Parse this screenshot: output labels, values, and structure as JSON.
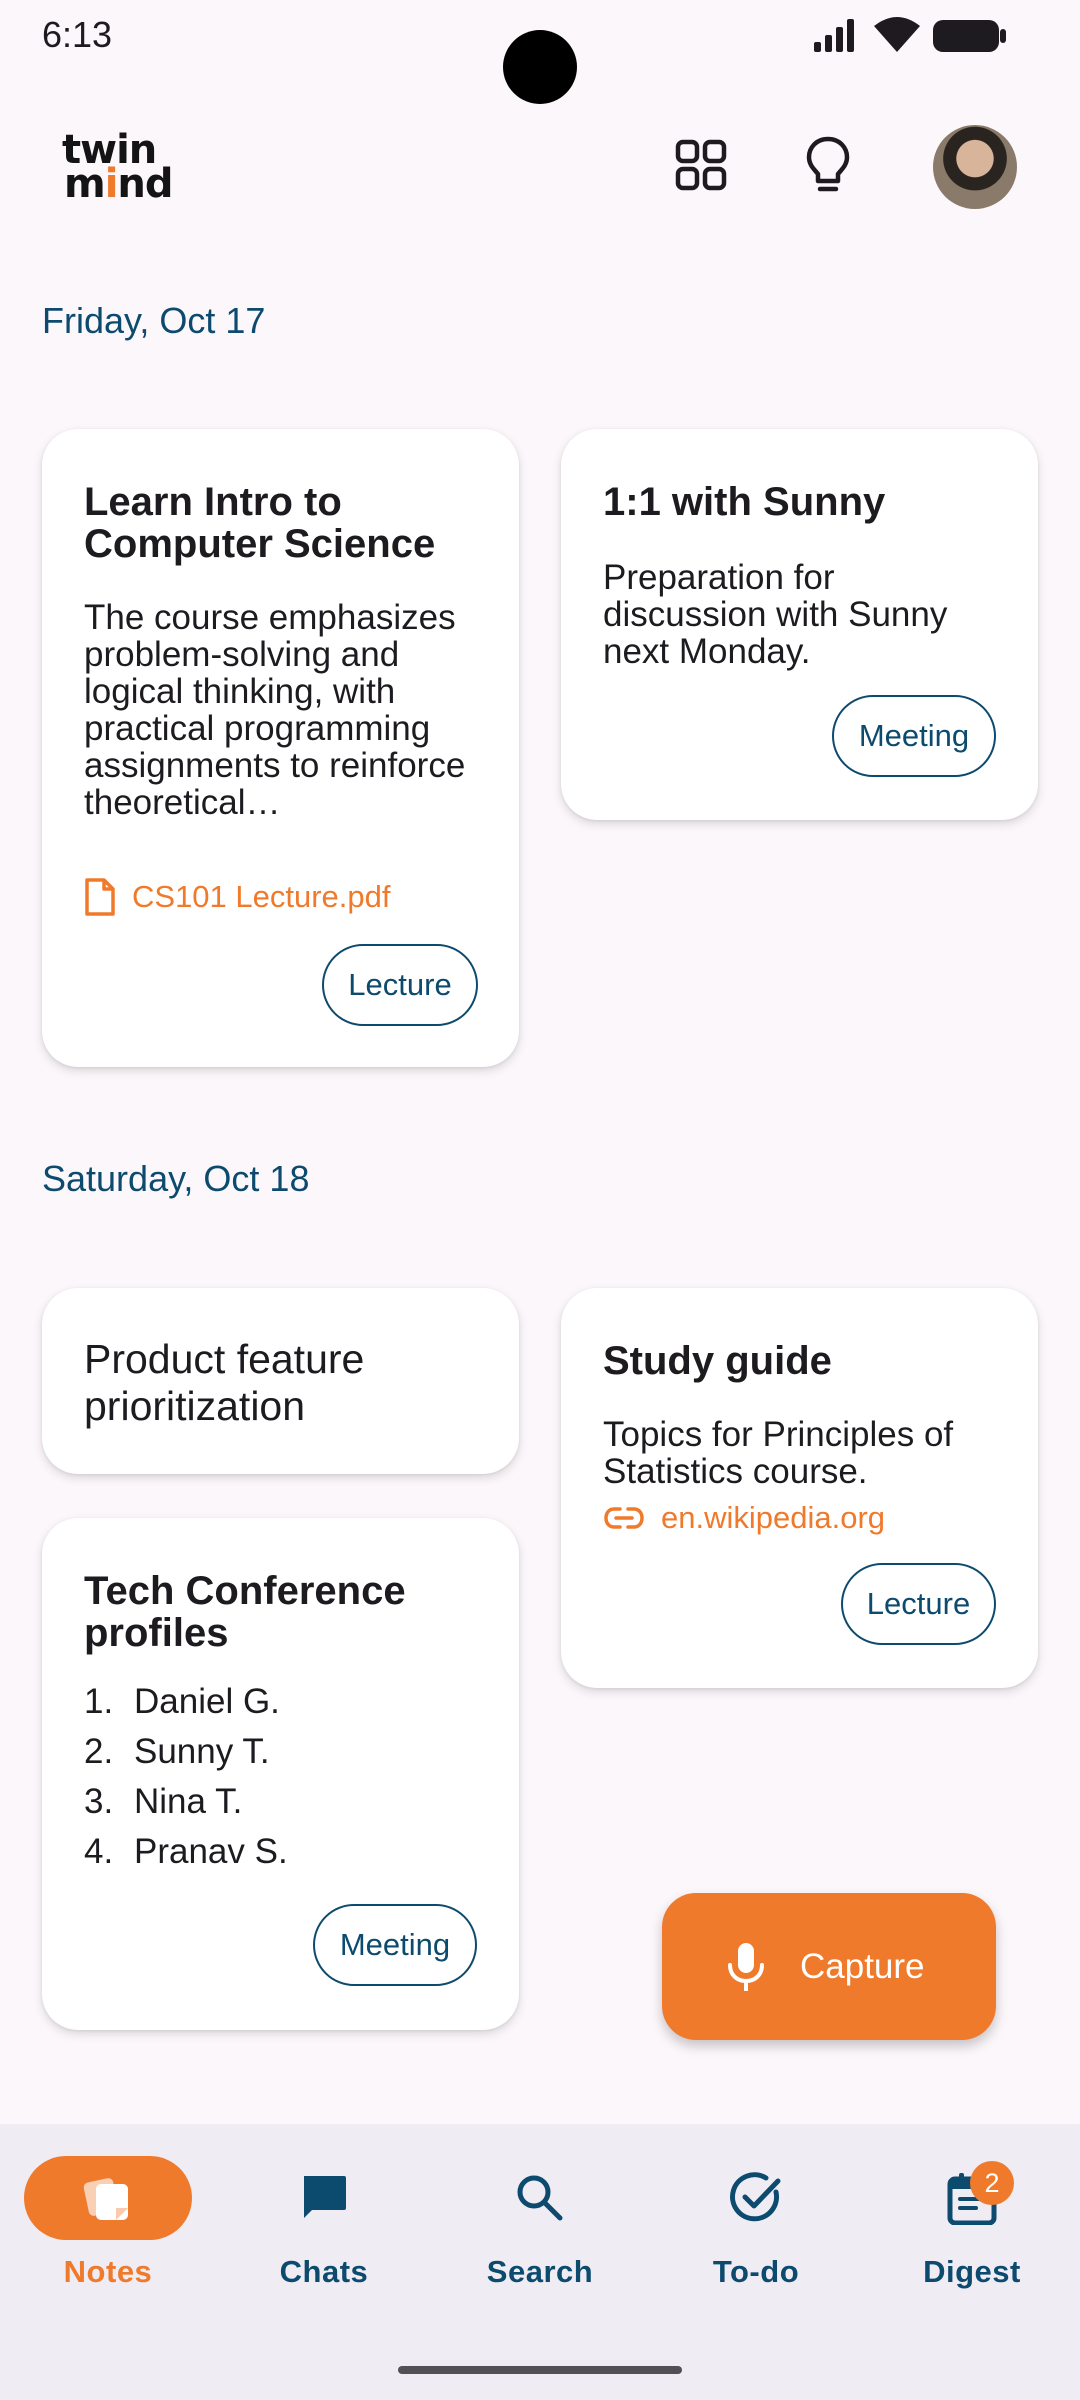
{
  "status_bar": {
    "time": "6:13"
  },
  "header": {
    "logo_line1": "twin",
    "logo_line2_pre": "m",
    "logo_line2_dot": "i",
    "logo_line2_post": "nd",
    "icons": [
      "grid-icon",
      "lightbulb-icon",
      "avatar"
    ]
  },
  "sections": [
    {
      "date": "Friday, Oct 17",
      "cards": [
        {
          "title": "Learn Intro to Computer Science",
          "body": "The course emphasizes problem-solving and logical thinking, with practical programming assignments to reinforce theoretical…",
          "attachment": "CS101 Lecture.pdf",
          "attachment_icon": "file-icon",
          "tag": "Lecture"
        },
        {
          "title": "1:1 with Sunny",
          "body": "Preparation for discussion with Sunny next Monday.",
          "tag": "Meeting"
        }
      ]
    },
    {
      "date": "Saturday, Oct 18",
      "cards": [
        {
          "title": "Product feature prioritization"
        },
        {
          "title": "Study guide",
          "body": "Topics for Principles of Statistics course.",
          "attachment": "en.wikipedia.org",
          "attachment_icon": "link-icon",
          "tag": "Lecture"
        },
        {
          "title": "Tech Conference profiles",
          "list": [
            {
              "num": "1.",
              "text": "Daniel G."
            },
            {
              "num": "2.",
              "text": "Sunny T."
            },
            {
              "num": "3.",
              "text": "Nina T."
            },
            {
              "num": "4.",
              "text": "Pranav S."
            }
          ],
          "tag": "Meeting"
        }
      ]
    }
  ],
  "fab": {
    "label": "Capture",
    "icon": "mic-icon"
  },
  "nav": {
    "items": [
      {
        "label": "Notes",
        "icon": "notes-icon",
        "active": true
      },
      {
        "label": "Chats",
        "icon": "chat-icon",
        "active": false
      },
      {
        "label": "Search",
        "icon": "search-icon",
        "active": false
      },
      {
        "label": "To-do",
        "icon": "check-circle-icon",
        "active": false
      },
      {
        "label": "Digest",
        "icon": "calendar-icon",
        "active": false
      }
    ],
    "digest_badge": "2"
  },
  "colors": {
    "accent": "#f07a2c",
    "primary": "#0c4a6e",
    "background": "#fcf7fb"
  }
}
